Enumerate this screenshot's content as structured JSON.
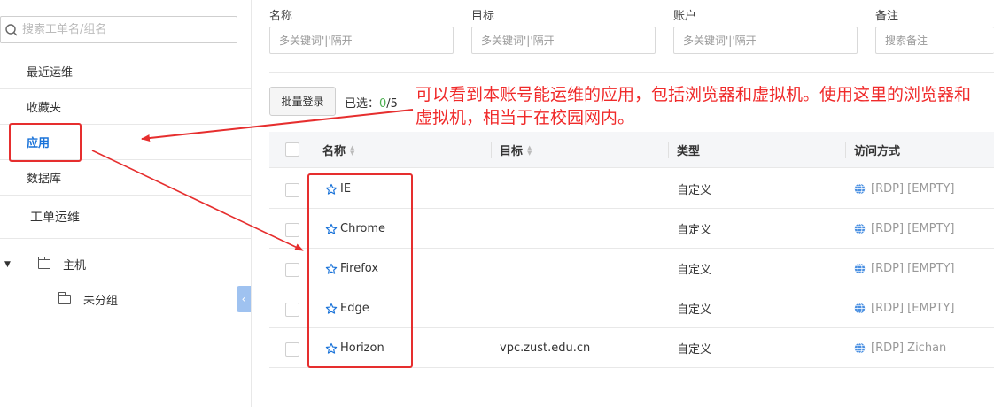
{
  "sidebar": {
    "search_placeholder": "搜索工单名/组名",
    "items": [
      {
        "label": "最近运维"
      },
      {
        "label": "收藏夹"
      },
      {
        "label": "应用"
      },
      {
        "label": "数据库"
      },
      {
        "label": "工单运维"
      }
    ],
    "tree": {
      "root": "主机",
      "child": "未分组"
    }
  },
  "filters": [
    {
      "label": "名称",
      "placeholder": "多关键词'|'隔开"
    },
    {
      "label": "目标",
      "placeholder": "多关键词'|'隔开"
    },
    {
      "label": "账户",
      "placeholder": "多关键词'|'隔开"
    },
    {
      "label": "备注",
      "placeholder": "搜索备注"
    }
  ],
  "toolbar": {
    "batch_login": "批量登录",
    "selected_label": "已选：",
    "selected_count": "0",
    "selected_total": "/5"
  },
  "annotation": "可以看到本账号能运维的应用，包括浏览器和虚拟机。使用这里的浏览器和虚拟机，相当于在校园网内。",
  "table": {
    "columns": [
      "名称",
      "目标",
      "类型",
      "访问方式"
    ],
    "rows": [
      {
        "name": "IE",
        "target": "",
        "type": "自定义",
        "access": "[RDP] [EMPTY]"
      },
      {
        "name": "Chrome",
        "target": "",
        "type": "自定义",
        "access": "[RDP] [EMPTY]"
      },
      {
        "name": "Firefox",
        "target": "",
        "type": "自定义",
        "access": "[RDP] [EMPTY]"
      },
      {
        "name": "Edge",
        "target": "",
        "type": "自定义",
        "access": "[RDP] [EMPTY]"
      },
      {
        "name": "Horizon",
        "target": "vpc.zust.edu.cn",
        "type": "自定义",
        "access": "[RDP] Zichan"
      }
    ]
  },
  "colors": {
    "accent": "#1a73d9",
    "annotation_red": "#e62e2e",
    "selected_green": "#4caf50",
    "globe_blue": "#4a90e2"
  }
}
